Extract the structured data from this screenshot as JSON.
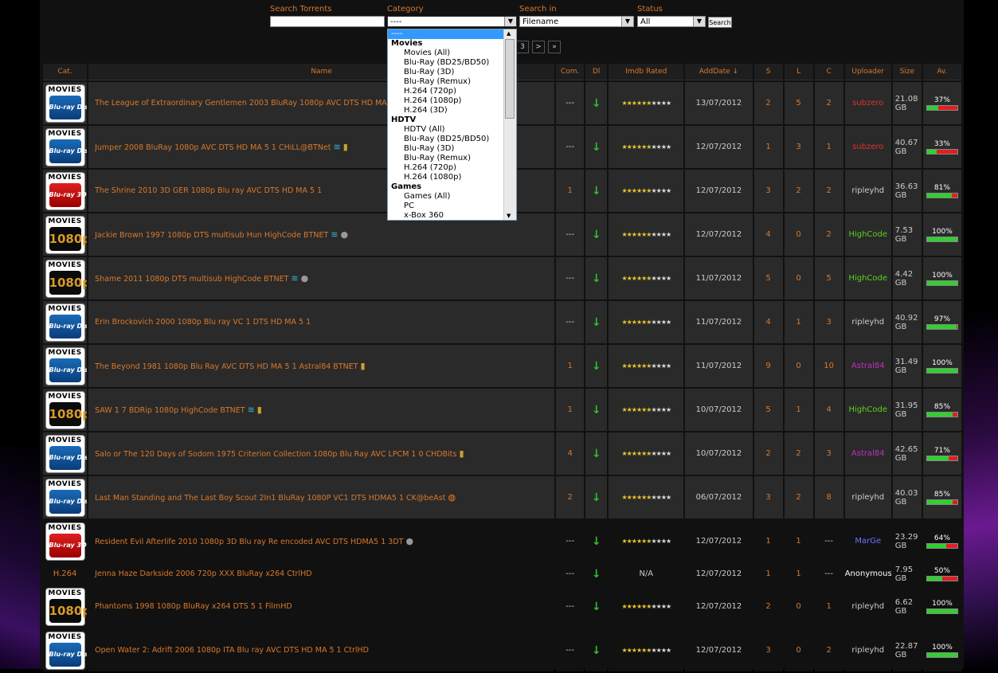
{
  "search": {
    "torrents_label": "Search Torrents",
    "torrents_value": "",
    "category_label": "Category",
    "category_value": "----",
    "searchin_label": "Search in",
    "searchin_value": "Filename",
    "status_label": "Status",
    "status_value": "All",
    "button": "Search"
  },
  "pager": [
    "3",
    ">",
    "»"
  ],
  "dropdown": [
    {
      "t": "----",
      "k": "sel"
    },
    {
      "t": "Movies",
      "k": "g"
    },
    {
      "t": "Movies (All)"
    },
    {
      "t": "Blu-Ray (BD25/BD50)"
    },
    {
      "t": "Blu-Ray (3D)"
    },
    {
      "t": "Blu-Ray (Remux)"
    },
    {
      "t": "H.264 (720p)"
    },
    {
      "t": "H.264 (1080p)"
    },
    {
      "t": "H.264 (3D)"
    },
    {
      "t": "HDTV",
      "k": "g"
    },
    {
      "t": "HDTV (All)"
    },
    {
      "t": "Blu-Ray (BD25/BD50)"
    },
    {
      "t": "Blu-Ray (3D)"
    },
    {
      "t": "Blu-Ray (Remux)"
    },
    {
      "t": "H.264 (720p)"
    },
    {
      "t": "H.264 (1080p)"
    },
    {
      "t": "Games",
      "k": "g"
    },
    {
      "t": "Games (All)"
    },
    {
      "t": "PC"
    },
    {
      "t": "x-Box 360"
    }
  ],
  "columns": [
    "Cat.",
    "Name",
    "Com.",
    "Dl",
    "Imdb Rated",
    "AddDate ↓",
    "S",
    "L",
    "C",
    "Uploader",
    "Size",
    "Av."
  ],
  "cat_labels": {
    "movies": "MOVIES",
    "bluray": "Blu-ray Disc",
    "threed": "Blu-ray 3D",
    "hd": "1080p",
    "h264": "H.264"
  },
  "colors": {
    "accent": "#d9782b",
    "uploader_red": "#e03030",
    "uploader_green": "#5fd020",
    "uploader_pink": "#c030c0",
    "uploader_blue": "#7070ff"
  },
  "rows": [
    {
      "cat": "bluray",
      "name": "The League of Extraordinary Gentlemen 2003 BluRay 1080p AVC DTS HD MA 5 1 C",
      "icons": [],
      "com": "---",
      "stars": 6,
      "date": "13/07/2012",
      "s": "2",
      "l": "5",
      "c": "2",
      "up": "subzero",
      "upc": "red",
      "size": "21.08 GB",
      "av": 37,
      "dark": false
    },
    {
      "cat": "bluray",
      "name": "Jumper 2008 BluRay 1080p AVC DTS HD MA 5 1 CHiLL@BTNet",
      "icons": [
        "birds",
        "coin"
      ],
      "com": "---",
      "stars": 6,
      "date": "12/07/2012",
      "s": "1",
      "l": "3",
      "c": "1",
      "up": "subzero",
      "upc": "red",
      "size": "40.67 GB",
      "av": 33,
      "dark": false
    },
    {
      "cat": "threed",
      "name": "The Shrine 2010 3D GER 1080p Blu ray AVC DTS HD MA 5 1",
      "icons": [],
      "com": "1",
      "stars": 6,
      "date": "12/07/2012",
      "s": "3",
      "l": "2",
      "c": "2",
      "up": "ripleyhd",
      "upc": "def",
      "size": "36.63 GB",
      "av": 81,
      "dark": false
    },
    {
      "cat": "hd",
      "name": "Jackie Brown 1997 1080p DTS multisub Hun HighCode BTNET",
      "icons": [
        "birds",
        "ball"
      ],
      "com": "---",
      "stars": 6,
      "date": "12/07/2012",
      "s": "4",
      "l": "0",
      "c": "2",
      "up": "HighCode",
      "upc": "green",
      "size": "7.53 GB",
      "av": 100,
      "dark": false
    },
    {
      "cat": "hd",
      "name": "Shame 2011 1080p DTS multisub HighCode BTNET",
      "icons": [
        "birds",
        "ball"
      ],
      "com": "---",
      "stars": 6,
      "date": "11/07/2012",
      "s": "5",
      "l": "0",
      "c": "5",
      "up": "HighCode",
      "upc": "green",
      "size": "4.42 GB",
      "av": 100,
      "dark": false
    },
    {
      "cat": "bluray",
      "name": "Erin Brockovich 2000 1080p Blu ray VC 1 DTS HD MA 5 1",
      "icons": [],
      "com": "---",
      "stars": 6,
      "date": "11/07/2012",
      "s": "4",
      "l": "1",
      "c": "3",
      "up": "ripleyhd",
      "upc": "def",
      "size": "40.92 GB",
      "av": 97,
      "dark": false
    },
    {
      "cat": "bluray",
      "name": "The Beyond 1981 1080p Blu Ray AVC DTS HD MA 5 1 Astral84 BTNET",
      "icons": [
        "coin"
      ],
      "com": "1",
      "stars": 6,
      "date": "11/07/2012",
      "s": "9",
      "l": "0",
      "c": "10",
      "up": "Astral84",
      "upc": "pink",
      "size": "31.49 GB",
      "av": 100,
      "dark": false
    },
    {
      "cat": "hd",
      "name": "SAW 1 7 BDRip 1080p HighCode BTNET",
      "icons": [
        "birds",
        "coin"
      ],
      "com": "1",
      "stars": 6,
      "date": "10/07/2012",
      "s": "5",
      "l": "1",
      "c": "4",
      "up": "HighCode",
      "upc": "green",
      "size": "31.95 GB",
      "av": 85,
      "dark": false
    },
    {
      "cat": "bluray",
      "name": "Salo or The 120 Days of Sodom 1975 Criterion Collection 1080p Blu Ray AVC LPCM 1 0 CHDBits",
      "icons": [
        "coin"
      ],
      "com": "4",
      "stars": 6,
      "date": "10/07/2012",
      "s": "2",
      "l": "2",
      "c": "3",
      "up": "Astral84",
      "upc": "pink",
      "size": "42.65 GB",
      "av": 71,
      "dark": false
    },
    {
      "cat": "bluray",
      "name": "Last Man Standing and The Last Boy Scout 2In1 BluRay 1080P VC1 DTS HDMA5 1 CK@beAst",
      "icons": [
        "orb"
      ],
      "com": "2",
      "stars": 6,
      "date": "06/07/2012",
      "s": "3",
      "l": "2",
      "c": "8",
      "up": "ripleyhd",
      "upc": "def",
      "size": "40.03 GB",
      "av": 85,
      "dark": false
    },
    {
      "cat": "threed",
      "name": "Resident Evil Afterlife 2010 1080p 3D Blu ray Re encoded AVC DTS HDMA5 1 3DT",
      "icons": [
        "ball"
      ],
      "com": "---",
      "stars": 6,
      "date": "12/07/2012",
      "s": "1",
      "l": "1",
      "c": "---",
      "up": "MarGe",
      "upc": "blue",
      "size": "23.29 GB",
      "av": 64,
      "dark": true
    },
    {
      "cat": "h264",
      "name": "Jenna Haze Darkside 2006 720p XXX BluRay x264 CtrlHD",
      "icons": [],
      "com": "---",
      "stars": -1,
      "date": "12/07/2012",
      "s": "1",
      "l": "1",
      "c": "---",
      "up": "Anonymous",
      "upc": "white",
      "size": "7.95 GB",
      "av": 50,
      "dark": true
    },
    {
      "cat": "hd",
      "name": "Phantoms 1998 1080p BluRay x264 DTS 5 1 FilmHD",
      "icons": [],
      "com": "---",
      "stars": 6,
      "date": "12/07/2012",
      "s": "2",
      "l": "0",
      "c": "1",
      "up": "ripleyhd",
      "upc": "def",
      "size": "6.62 GB",
      "av": 100,
      "dark": true
    },
    {
      "cat": "bluray",
      "name": "Open Water 2: Adrift 2006 1080p ITA Blu ray AVC DTS HD MA 5 1 CtrlHD",
      "icons": [],
      "com": "---",
      "stars": 6,
      "date": "12/07/2012",
      "s": "3",
      "l": "0",
      "c": "2",
      "up": "ripleyhd",
      "upc": "def",
      "size": "22.87 GB",
      "av": 100,
      "dark": true
    }
  ],
  "na_label": "N/A"
}
